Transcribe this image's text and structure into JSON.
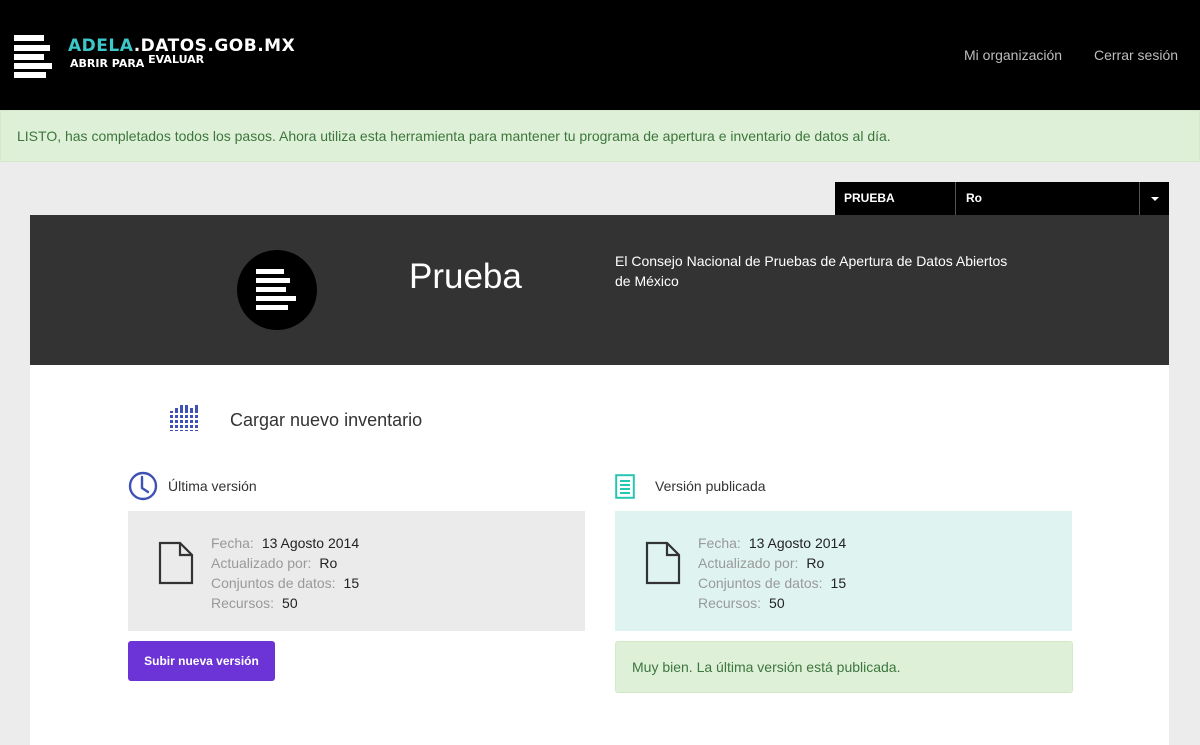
{
  "header": {
    "brand_accent": "ADELA",
    "brand_rest": ".DATOS.GOB.MX",
    "tagline_1": "ABRIR PARA",
    "tagline_2": "EVALUAR",
    "nav": [
      {
        "label": "Mi organización"
      },
      {
        "label": "Cerrar sesión"
      }
    ]
  },
  "banner": {
    "message": "LISTO, has completados todos los pasos. Ahora utiliza esta herramienta para mantener tu programa de apertura e inventario de datos al día."
  },
  "selector": {
    "organization": "PRUEBA",
    "user": "Ro"
  },
  "organization": {
    "name": "Prueba",
    "description": "El Consejo Nacional de Pruebas de Apertura de Datos Abiertos de México"
  },
  "inventory": {
    "upload_label": "Cargar nuevo inventario"
  },
  "latest_version": {
    "heading": "Última versión",
    "fecha_label": "Fecha:",
    "fecha": "13 Agosto 2014",
    "updated_by_label": "Actualizado por:",
    "updated_by": "Ro",
    "datasets_label": "Conjuntos de datos:",
    "datasets": "15",
    "resources_label": "Recursos:",
    "resources": "50",
    "button": "Subir nueva versión"
  },
  "published_version": {
    "heading": "Versión publicada",
    "fecha_label": "Fecha:",
    "fecha": "13 Agosto 2014",
    "updated_by_label": "Actualizado por:",
    "updated_by": "Ro",
    "datasets_label": "Conjuntos de datos:",
    "datasets": "15",
    "resources_label": "Recursos:",
    "resources": "50",
    "status_message": "Muy bien. La última versión está publicada."
  },
  "colors": {
    "brand_accent": "#3cc8c8",
    "primary_button": "#6c34d6",
    "icon_indigo": "#3f51b5",
    "icon_teal": "#26c6b4",
    "success_bg": "#dff0d8",
    "success_text": "#3c763d"
  },
  "icons": {
    "logo": "stacked-bars-logo-icon",
    "inventory": "grid-inventory-icon",
    "latest": "clock-icon",
    "published": "document-lines-icon",
    "file": "file-outline-icon",
    "dropdown": "caret-down-icon"
  }
}
